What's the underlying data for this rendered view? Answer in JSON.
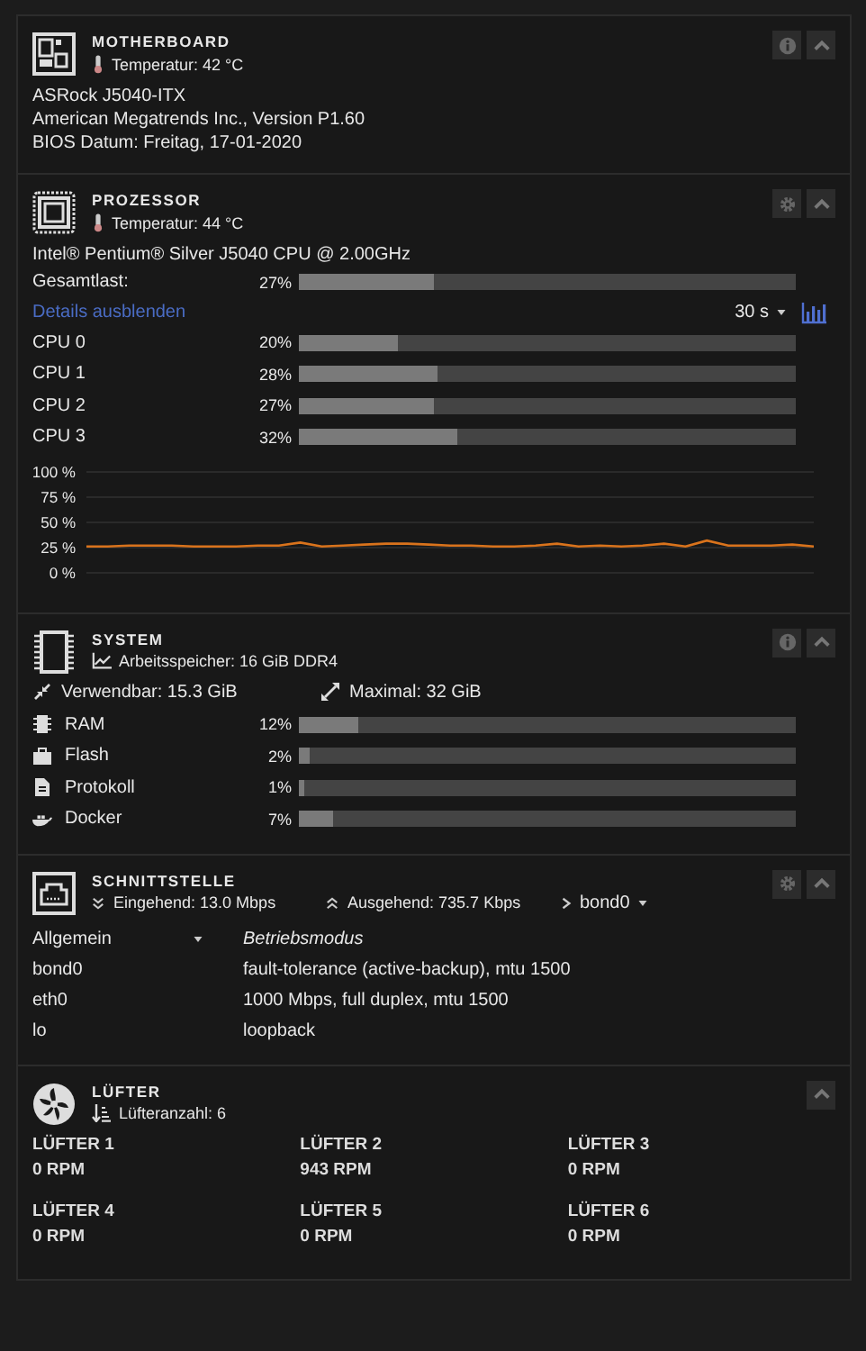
{
  "motherboard": {
    "title": "MOTHERBOARD",
    "temperature": "Temperatur: 42 °C",
    "buttons": [
      {
        "kind": "info"
      },
      {
        "kind": "collapse"
      }
    ],
    "lines": [
      "ASRock J5040-ITX",
      "American Megatrends Inc., Version P1.60",
      "BIOS Datum: Freitag, 17-01-2020"
    ]
  },
  "processor": {
    "title": "PROZESSOR",
    "temperature": "Temperatur: 44 °C",
    "buttons": [
      {
        "kind": "settings"
      },
      {
        "kind": "collapse"
      }
    ],
    "model": "Intel® Pentium® Silver J5040 CPU @ 2.00GHz",
    "total": {
      "label": "Gesamtlast:",
      "reading": "27%",
      "level": 0.27
    },
    "details_link": "Details ausblenden",
    "interval": "30 s",
    "cores": [
      {
        "label": "CPU 0",
        "reading": "20%",
        "level": 0.2
      },
      {
        "label": "CPU 1",
        "reading": "28%",
        "level": 0.28
      },
      {
        "label": "CPU 2",
        "reading": "27%",
        "level": 0.27
      },
      {
        "label": "CPU 3",
        "reading": "32%",
        "level": 0.32
      }
    ],
    "chart_data": {
      "type": "line",
      "grid": true,
      "ylim": [
        0,
        100
      ],
      "yticks": [
        {
          "value": 100,
          "label": "100 %"
        },
        {
          "value": 75,
          "label": "75 %"
        },
        {
          "value": 50,
          "label": "50 %"
        },
        {
          "value": 25,
          "label": "25 %"
        },
        {
          "value": 0,
          "label": "0 %"
        }
      ],
      "series": [
        {
          "color": "#d9731c",
          "values": [
            26,
            26,
            27,
            27,
            27,
            26,
            26,
            26,
            27,
            27,
            30,
            26,
            27,
            28,
            29,
            29,
            28,
            27,
            27,
            26,
            26,
            27,
            29,
            26,
            27,
            26,
            27,
            29,
            26,
            32,
            27,
            27,
            27,
            28,
            26
          ]
        }
      ]
    }
  },
  "system": {
    "title": "SYSTEM",
    "memory": "Arbeitsspeicher: 16 GiB DDR4",
    "buttons": [
      {
        "kind": "info"
      },
      {
        "kind": "collapse"
      }
    ],
    "usable": "Verwendbar: 15.3 GiB",
    "maximum": "Maximal: 32 GiB",
    "usage": [
      {
        "kind": "ram",
        "label": "RAM",
        "reading": "12%",
        "level": 0.12
      },
      {
        "kind": "flash",
        "label": "Flash",
        "reading": "2%",
        "level": 0.02
      },
      {
        "kind": "log",
        "label": "Protokoll",
        "reading": "1%",
        "level": 0.01
      },
      {
        "kind": "docker",
        "label": "Docker",
        "reading": "7%",
        "level": 0.07
      }
    ]
  },
  "interface": {
    "title": "SCHNITTSTELLE",
    "inbound": "Eingehend: 13.0 Mbps",
    "outbound": "Ausgehend: 735.7 Kbps",
    "selected_interface": "bond0",
    "buttons": [
      {
        "kind": "settings"
      },
      {
        "kind": "collapse"
      }
    ],
    "columns": [
      "Allgemein",
      "Betriebsmodus"
    ],
    "rows": [
      {
        "name": "bond0",
        "mode": "fault-tolerance (active-backup), mtu 1500"
      },
      {
        "name": "eth0",
        "mode": "1000 Mbps, full duplex, mtu 1500"
      },
      {
        "name": "lo",
        "mode": "loopback"
      }
    ]
  },
  "fans": {
    "title": "LÜFTER",
    "count": "Lüfteranzahl: 6",
    "buttons": [
      {
        "kind": "collapse"
      }
    ],
    "items": [
      {
        "name": "LÜFTER 1",
        "reading": "0 RPM"
      },
      {
        "name": "LÜFTER 2",
        "reading": "943 RPM"
      },
      {
        "name": "LÜFTER 3",
        "reading": "0 RPM"
      },
      {
        "name": "LÜFTER 4",
        "reading": "0 RPM"
      },
      {
        "name": "LÜFTER 5",
        "reading": "0 RPM"
      },
      {
        "name": "LÜFTER 6",
        "reading": "0 RPM"
      }
    ]
  }
}
